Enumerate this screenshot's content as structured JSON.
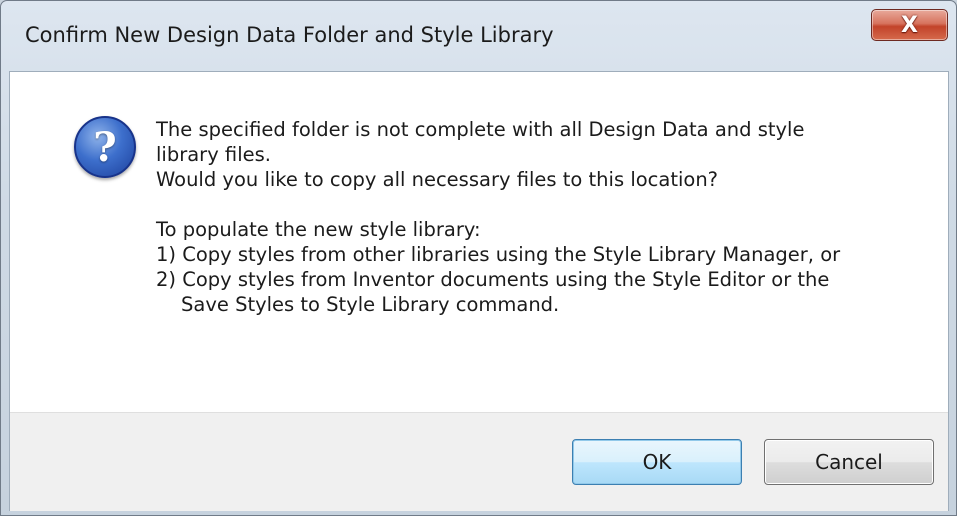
{
  "dialog": {
    "title": "Confirm New Design Data Folder and Style Library",
    "close_glyph": "X",
    "icon": {
      "name": "question-icon",
      "glyph": "?"
    },
    "message": {
      "line1": "The specified folder is not complete with all Design Data and style",
      "line2": "library files.",
      "line3": "Would you like to copy all necessary files to this location?",
      "line4": "To populate the new style library:",
      "line5": "1) Copy styles from other libraries using the Style Library Manager, or",
      "line6": "2) Copy styles from Inventor documents using the Style Editor or the",
      "line7": "Save Styles to Style Library command."
    },
    "buttons": {
      "ok": "OK",
      "cancel": "Cancel"
    }
  }
}
